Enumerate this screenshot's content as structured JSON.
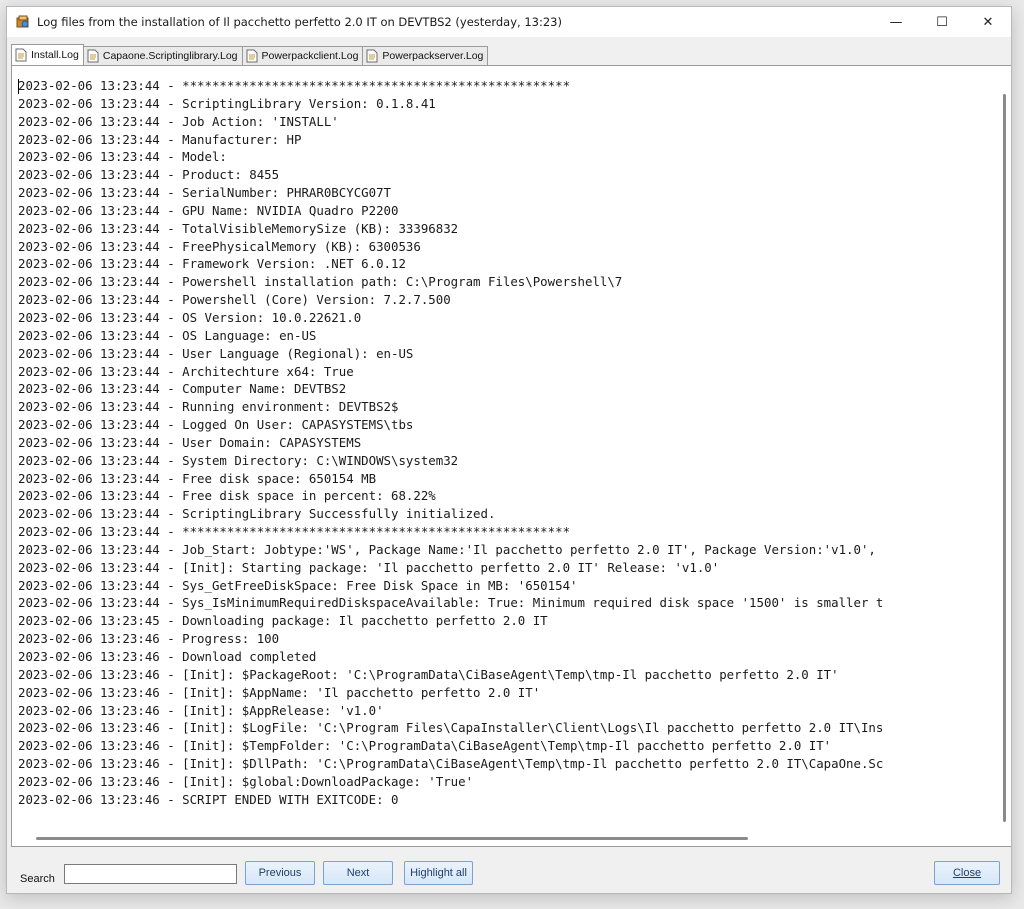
{
  "window": {
    "title": "Log files from the installation of Il pacchetto perfetto 2.0 IT on DEVTBS2 (yesterday, 13:23)",
    "minimize": "—",
    "maximize": "☐",
    "close": "✕"
  },
  "tabs": [
    {
      "label": "Install.Log",
      "active": true
    },
    {
      "label": "Capaone.Scriptinglibrary.Log",
      "active": false
    },
    {
      "label": "Powerpackclient.Log",
      "active": false
    },
    {
      "label": "Powerpackserver.Log",
      "active": false
    }
  ],
  "log": {
    "lines": [
      "2023-02-06 13:23:44 - ****************************************************",
      "2023-02-06 13:23:44 - ScriptingLibrary Version: 0.1.8.41",
      "2023-02-06 13:23:44 - Job Action: 'INSTALL'",
      "2023-02-06 13:23:44 - Manufacturer: HP",
      "2023-02-06 13:23:44 - Model:",
      "2023-02-06 13:23:44 - Product: 8455",
      "2023-02-06 13:23:44 - SerialNumber: PHRAR0BCYCG07T",
      "2023-02-06 13:23:44 - GPU Name: NVIDIA Quadro P2200",
      "2023-02-06 13:23:44 - TotalVisibleMemorySize (KB): 33396832",
      "2023-02-06 13:23:44 - FreePhysicalMemory (KB): 6300536",
      "2023-02-06 13:23:44 - Framework Version: .NET 6.0.12",
      "2023-02-06 13:23:44 - Powershell installation path: C:\\Program Files\\Powershell\\7",
      "2023-02-06 13:23:44 - Powershell (Core) Version: 7.2.7.500",
      "2023-02-06 13:23:44 - OS Version: 10.0.22621.0",
      "2023-02-06 13:23:44 - OS Language: en-US",
      "2023-02-06 13:23:44 - User Language (Regional): en-US",
      "2023-02-06 13:23:44 - Architechture x64: True",
      "2023-02-06 13:23:44 - Computer Name: DEVTBS2",
      "2023-02-06 13:23:44 - Running environment: DEVTBS2$",
      "2023-02-06 13:23:44 - Logged On User: CAPASYSTEMS\\tbs",
      "2023-02-06 13:23:44 - User Domain: CAPASYSTEMS",
      "2023-02-06 13:23:44 - System Directory: C:\\WINDOWS\\system32",
      "2023-02-06 13:23:44 - Free disk space: 650154 MB",
      "2023-02-06 13:23:44 - Free disk space in percent: 68.22%",
      "2023-02-06 13:23:44 - ScriptingLibrary Successfully initialized.",
      "2023-02-06 13:23:44 - ****************************************************",
      "2023-02-06 13:23:44 - Job_Start: Jobtype:'WS', Package Name:'Il pacchetto perfetto 2.0 IT', Package Version:'v1.0',",
      "2023-02-06 13:23:44 - [Init]: Starting package: 'Il pacchetto perfetto 2.0 IT' Release: 'v1.0'",
      "2023-02-06 13:23:44 - Sys_GetFreeDiskSpace: Free Disk Space in MB: '650154'",
      "2023-02-06 13:23:44 - Sys_IsMinimumRequiredDiskspaceAvailable: True: Minimum required disk space '1500' is smaller t",
      "2023-02-06 13:23:45 - Downloading package: Il pacchetto perfetto 2.0 IT",
      "2023-02-06 13:23:46 - Progress: 100",
      "2023-02-06 13:23:46 - Download completed",
      "2023-02-06 13:23:46 - [Init]: $PackageRoot: 'C:\\ProgramData\\CiBaseAgent\\Temp\\tmp-Il pacchetto perfetto 2.0 IT'",
      "2023-02-06 13:23:46 - [Init]: $AppName: 'Il pacchetto perfetto 2.0 IT'",
      "2023-02-06 13:23:46 - [Init]: $AppRelease: 'v1.0'",
      "2023-02-06 13:23:46 - [Init]: $LogFile: 'C:\\Program Files\\CapaInstaller\\Client\\Logs\\Il pacchetto perfetto 2.0 IT\\Ins",
      "2023-02-06 13:23:46 - [Init]: $TempFolder: 'C:\\ProgramData\\CiBaseAgent\\Temp\\tmp-Il pacchetto perfetto 2.0 IT'",
      "2023-02-06 13:23:46 - [Init]: $DllPath: 'C:\\ProgramData\\CiBaseAgent\\Temp\\tmp-Il pacchetto perfetto 2.0 IT\\CapaOne.Sc",
      "2023-02-06 13:23:46 - [Init]: $global:DownloadPackage: 'True'",
      "2023-02-06 13:23:46 - SCRIPT ENDED WITH EXITCODE: 0"
    ]
  },
  "search": {
    "label": "Search",
    "value": "",
    "placeholder": ""
  },
  "buttons": {
    "previous": "Previous",
    "next": "Next",
    "highlight_all": "Highlight all",
    "close": "Close"
  },
  "colors": {
    "button_border": "#7da2ce",
    "button_text": "#1f3f6b",
    "window_bg": "#f0f0f0"
  }
}
